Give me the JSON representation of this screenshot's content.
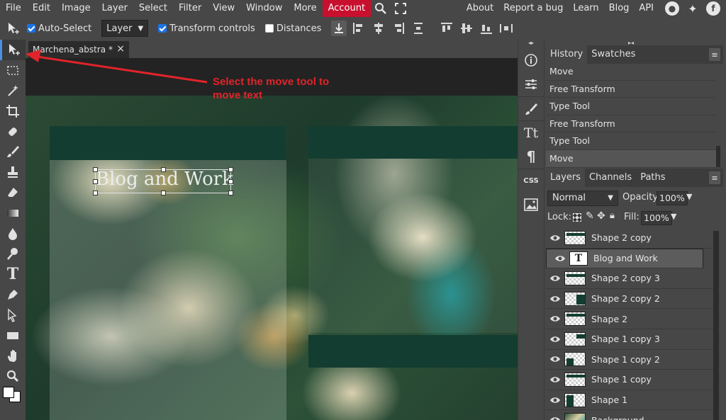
{
  "menu": {
    "items": [
      "File",
      "Edit",
      "Image",
      "Layer",
      "Select",
      "Filter",
      "View",
      "Window",
      "More"
    ],
    "account": "Account",
    "right_items": [
      "About",
      "Report a bug",
      "Learn",
      "Blog",
      "API"
    ]
  },
  "options": {
    "auto_select_label": "Auto-Select",
    "auto_select_checked": true,
    "layer_select_value": "Layer",
    "transform_controls_label": "Transform controls",
    "transform_controls_checked": true,
    "distances_label": "Distances",
    "distances_checked": false
  },
  "toolbar": {
    "tools": [
      "move-tool",
      "marquee-tool",
      "magic-wand-tool",
      "crop-tool",
      "healing-tool",
      "brush-tool",
      "stamp-tool",
      "eraser-tool",
      "gradient-tool",
      "blur-tool",
      "dodge-tool",
      "type-tool",
      "pen-tool",
      "path-select-tool",
      "shape-tool",
      "hand-tool",
      "zoom-tool",
      "color-swatches"
    ],
    "active": "move-tool"
  },
  "document": {
    "tab_title": "Marchena_abstra *",
    "close_label": "×"
  },
  "canvas": {
    "text_layer_content": "Blog and Work"
  },
  "annotation": {
    "line1": "Select the move tool to",
    "line2": "move text",
    "color": "#e0242a"
  },
  "mini_panel": {
    "css_label": "CSS"
  },
  "history_panel": {
    "tabs": [
      "History",
      "Swatches"
    ],
    "items": [
      "Move",
      "Free Transform",
      "Type Tool",
      "Free Transform",
      "Type Tool",
      "Move"
    ]
  },
  "layers_panel": {
    "tabs": [
      "Layers",
      "Channels",
      "Paths"
    ],
    "blend_mode": "Normal",
    "opacity_label": "Opacity:",
    "opacity_value": "100%",
    "lock_label": "Lock:",
    "fill_label": "Fill:",
    "fill_value": "100%",
    "layers": [
      {
        "name": "Shape 2 copy",
        "kind": "shape",
        "selected": false
      },
      {
        "name": "Blog and Work",
        "kind": "text",
        "selected": true
      },
      {
        "name": "Shape 2 copy 3",
        "kind": "shape",
        "selected": false
      },
      {
        "name": "Shape 2 copy 2",
        "kind": "shape",
        "selected": false
      },
      {
        "name": "Shape 2",
        "kind": "shape",
        "selected": false
      },
      {
        "name": "Shape 1 copy 3",
        "kind": "shape",
        "selected": false
      },
      {
        "name": "Shape 1 copy 2",
        "kind": "shape",
        "selected": false
      },
      {
        "name": "Shape 1 copy",
        "kind": "shape",
        "selected": false
      },
      {
        "name": "Shape 1",
        "kind": "shape",
        "selected": false
      },
      {
        "name": "Background",
        "kind": "image",
        "selected": false
      }
    ]
  },
  "colors": {
    "account_bg": "#c8102e",
    "accent": "#4a90e2",
    "shape_green": "#143d31",
    "ui_bg": "#474747"
  }
}
